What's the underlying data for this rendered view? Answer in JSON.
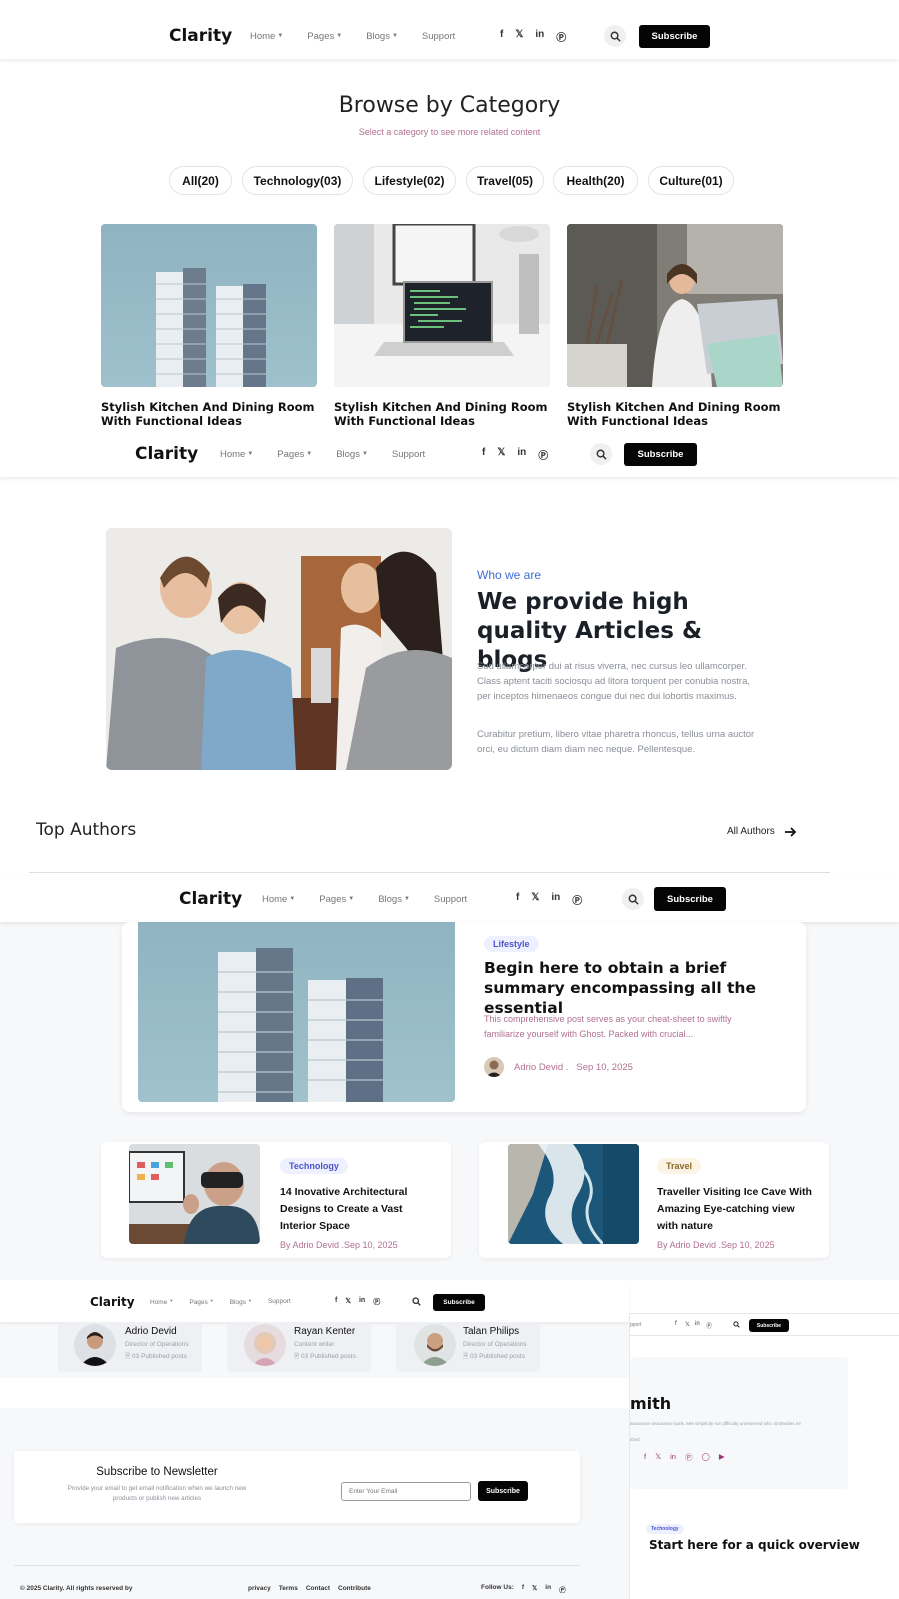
{
  "nav": {
    "logo": "Clarity",
    "menu": [
      "Home",
      "Pages",
      "Blogs",
      "Support"
    ],
    "social": [
      "f",
      "t",
      "in",
      "p"
    ],
    "subscribe": "Subscribe"
  },
  "category": {
    "title": "Browse by Category",
    "subtitle": "Select a category to see more related content",
    "pills": [
      "All(20)",
      "Technology(03)",
      "Lifestyle(02)",
      "Travel(05)",
      "Health(20)",
      "Culture(01)"
    ],
    "cards": [
      {
        "title": "Stylish Kitchen And Dining Room With Functional Ideas"
      },
      {
        "title": "Stylish Kitchen And Dining Room With Functional Ideas"
      },
      {
        "title": "Stylish Kitchen And Dining Room With Functional Ideas"
      }
    ]
  },
  "about": {
    "eyebrow": "Who we are",
    "heading": "We provide high quality Articles & blogs",
    "p1": "Sed ullamcorper dui at risus viverra, nec cursus leo ullamcorper. Class aptent taciti sociosqu ad litora torquent per conubia nostra, per inceptos himenaeos congue dui nec dui lobortis maximus.",
    "p2": "Curabitur pretium, libero vitae pharetra rhoncus, tellus urna auctor orci, eu dictum diam diam nec neque. Pellentesque."
  },
  "authors_header": {
    "title": "Top Authors",
    "link": "All Authors"
  },
  "featured": {
    "tag": "Lifestyle",
    "title": "Begin here to obtain a brief summary encompassing all the essential",
    "excerpt": "This comprehensive post serves as your cheat-sheet to swiftly familiarize yourself with Ghost. Packed with crucial...",
    "author": "Adrio Devid .",
    "date": "Sep 10, 2025"
  },
  "posts": [
    {
      "tag": "Technology",
      "title": "14 Inovative Architectural Designs to Create a Vast Interior Space",
      "meta": "By Adrio Devid .Sep 10, 2025"
    },
    {
      "tag": "Travel",
      "title": "Traveller Visiting Ice Cave With Amazing Eye-catching view with nature",
      "meta": "By Adrio Devid .Sep 10, 2025"
    }
  ],
  "authors": [
    {
      "name": "Adrio Devid",
      "role": "Director of Operations",
      "posts": "03 Published posts"
    },
    {
      "name": "Rayan Kenter",
      "role": "Content writer",
      "posts": "03 Published posts"
    },
    {
      "name": "Talan Philips",
      "role": "Director of Operations",
      "posts": "03 Published posts"
    }
  ],
  "newsletter": {
    "title": "Subscribe to Newsletter",
    "text": "Provide your email to get email notification when we launch new products or publish new articles",
    "placeholder": "Enter Your Email",
    "button": "Subscribe"
  },
  "footer": {
    "copyright": "© 2025 Clarity. All rights reserved by",
    "links": [
      "privacy",
      "Terms",
      "Contact",
      "Contribute"
    ],
    "follow": "Follow Us:"
  },
  "overlay": {
    "nav_support": "pport",
    "name_partial": "mith",
    "bio_partial": "assurance assurance bank. Met simplicity nor difficulty unreserved who. Entreaties mr",
    "bio_partial2": "icted.",
    "tag": "Technology",
    "heading": "Start here for a quick overview"
  },
  "colors": {
    "accent_blue": "#3d6fd6",
    "tag_lavender": "#eef0ff",
    "tag_travel": "#fbf3e4",
    "muted_text": "#8a8f99",
    "pink_text": "#b0708f"
  }
}
